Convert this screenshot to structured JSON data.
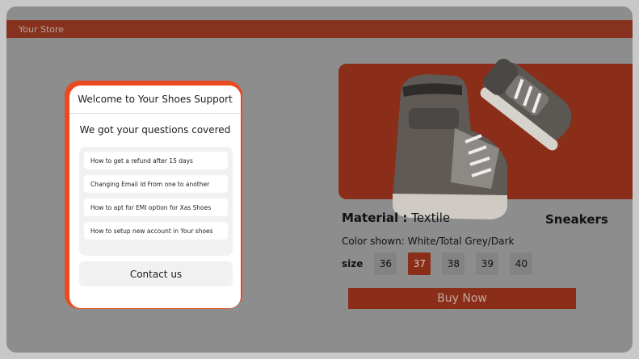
{
  "store": {
    "name": "Your Store"
  },
  "product": {
    "material_label": "Material :",
    "material_value": "Textile",
    "name": "Sneakers",
    "color_label": "Color shown:",
    "color_value": "White/Total Grey/Dark",
    "size_label": "size",
    "sizes": [
      "36",
      "37",
      "38",
      "39",
      "40"
    ],
    "selected_size": "37",
    "buy_label": "Buy Now"
  },
  "support": {
    "title": "Welcome to Your Shoes Support",
    "subtitle": "We got your questions covered",
    "faqs": [
      "How to get a refund after 15 days",
      "Changing Email Id From one to another",
      "How to apt for EMI option for Xas Shoes",
      "How to setup new account in Your shoes"
    ],
    "contact_label": "Contact us"
  },
  "colors": {
    "accent": "#ea4a20",
    "dimmed_accent": "#8a2e19",
    "overlay": "#8d8d8d"
  },
  "icons": {
    "product_image": "sneaker-image"
  }
}
